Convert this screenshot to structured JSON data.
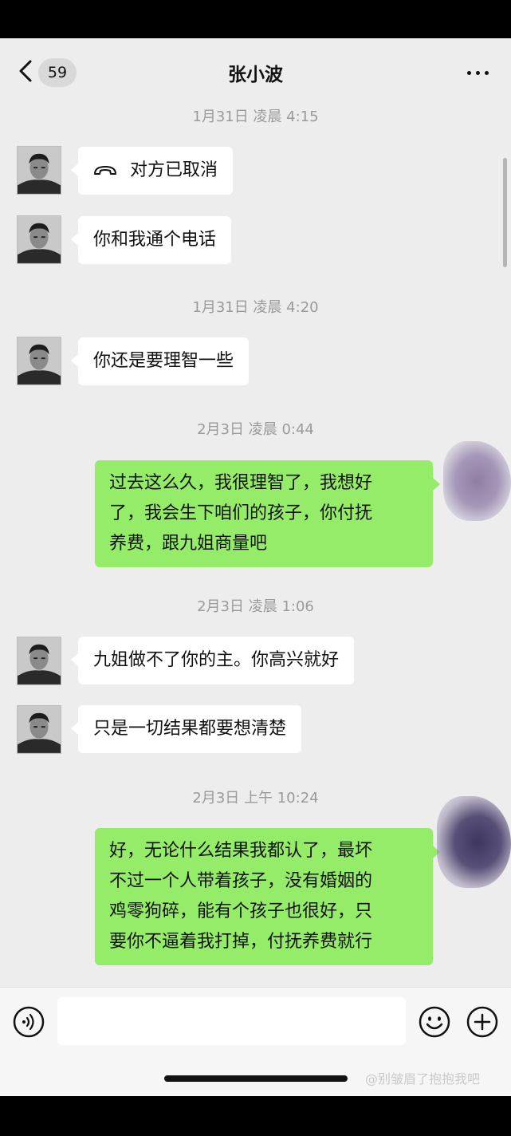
{
  "header": {
    "back_icon": "chevron-left-icon",
    "unread_count": "59",
    "title": "张小波",
    "more_icon": "more-dots-icon"
  },
  "messages": [
    {
      "type": "timestamp",
      "text": "1月31日 凌晨 4:15"
    },
    {
      "type": "call",
      "sender": "contact",
      "icon": "phone-hangup-icon",
      "text": "对方已取消"
    },
    {
      "type": "text",
      "sender": "contact",
      "text": "你和我通个电话"
    },
    {
      "type": "timestamp",
      "text": "1月31日 凌晨 4:20"
    },
    {
      "type": "text",
      "sender": "contact",
      "text": "你还是要理智一些"
    },
    {
      "type": "timestamp",
      "text": "2月3日 凌晨 0:44"
    },
    {
      "type": "text",
      "sender": "me",
      "lines": [
        "过去这么久，我很理智了，我想好",
        "了，我会生下咱们的孩子，你付抚",
        "养费，跟九姐商量吧"
      ]
    },
    {
      "type": "timestamp",
      "text": "2月3日 凌晨 1:06"
    },
    {
      "type": "text",
      "sender": "contact",
      "text": "九姐做不了你的主。你高兴就好"
    },
    {
      "type": "text",
      "sender": "contact",
      "text": "只是一切结果都要想清楚"
    },
    {
      "type": "timestamp",
      "text": "2月3日 上午 10:24"
    },
    {
      "type": "text",
      "sender": "me",
      "lines": [
        "好，无论什么结果我都认了，最坏",
        "不过一个人带着孩子，没有婚姻的",
        "鸡零狗碎，能有个孩子也很好，只",
        "要你不逼着我打掉，付抚养费就行"
      ]
    }
  ],
  "input_bar": {
    "voice_icon": "voice-icon",
    "emoji_icon": "emoji-icon",
    "plus_icon": "plus-icon",
    "input_value": ""
  },
  "watermark": "@别皱眉了抱抱我吧",
  "colors": {
    "background": "#ededed",
    "incoming_bubble": "#ffffff",
    "outgoing_bubble": "#95ec69",
    "timestamp_text": "#9a9a9a"
  }
}
